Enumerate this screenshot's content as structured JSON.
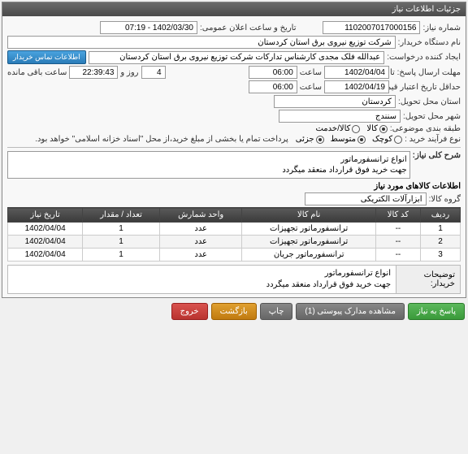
{
  "panel_title": "جزئیات اطلاعات نیاز",
  "fields": {
    "need_no_label": "شماره نیاز:",
    "need_no": "1102007017000156",
    "announce_label": "تاریخ و ساعت اعلان عمومی:",
    "announce": "1402/03/30 - 07:19",
    "buyer_label": "نام دستگاه خریدار:",
    "buyer": "شرکت توزیع نیروی برق استان کردستان",
    "creator_label": "ایجاد کننده درخواست:",
    "creator": "عبدالله فلک مجدی کارشناس تدارکات شرکت توزیع نیروی برق استان کردستان",
    "contact_btn": "اطلاعات تماس خریدار",
    "deadline_label": "مهلت ارسال پاسخ:",
    "until": "تا تاریخ:",
    "deadline_date": "1402/04/04",
    "hour_label": "ساعت",
    "deadline_hour": "06:00",
    "days": "4",
    "days_label": "روز و",
    "remain": "22:39:43",
    "remain_label": "ساعت باقی مانده",
    "valid_label": "حداقل تاریخ اعتبار قیمت تا تاریخ:",
    "valid_date": "1402/04/19",
    "valid_hour": "06:00",
    "province_label": "استان محل تحویل:",
    "province": "کردستان",
    "city_label": "شهر محل تحویل:",
    "city": "سنندج",
    "class_label": "طبقه بندی موضوعی:",
    "opt_kala": "کالا",
    "opt_service": "کالا/خدمت",
    "process_label": "نوع فرآیند خرید :",
    "opt_small": "کوچک",
    "opt_medium": "متوسط",
    "opt_partial": "جزئی",
    "process_note": "پرداخت تمام یا بخشی از مبلغ خرید،از محل \"اسناد خزانه اسلامی\" خواهد بود.",
    "desc_label": "شرح کلی نیاز:",
    "desc_line1": "انواع ترانسفورماتور",
    "desc_line2": "جهت خرید فوق قرارداد منعقد میگردد",
    "items_title": "اطلاعات کالاهای مورد نیاز",
    "group_label": "گروه کالا:",
    "group": "ابزارآلات الکتریکی"
  },
  "table": {
    "headers": [
      "ردیف",
      "کد کالا",
      "نام کالا",
      "واحد شمارش",
      "تعداد / مقدار",
      "تاریخ نیاز"
    ],
    "rows": [
      {
        "idx": "1",
        "code": "--",
        "name": "ترانسفورماتور تجهیزات",
        "unit": "عدد",
        "qty": "1",
        "date": "1402/04/04"
      },
      {
        "idx": "2",
        "code": "--",
        "name": "ترانسفورماتور تجهیزات",
        "unit": "عدد",
        "qty": "1",
        "date": "1402/04/04"
      },
      {
        "idx": "3",
        "code": "--",
        "name": "ترانسفورماتور جریان",
        "unit": "عدد",
        "qty": "1",
        "date": "1402/04/04"
      }
    ]
  },
  "buyer_notes_label": "توضیحات خریدار:",
  "buyer_notes_l1": "انواع ترانسفورماتور",
  "buyer_notes_l2": "جهت خرید فوق قرارداد منعقد میگردد",
  "buttons": {
    "reply": "پاسخ به نیاز",
    "attach": "مشاهده مدارک پیوستی (1)",
    "print": "چاپ",
    "back": "بازگشت",
    "exit": "خروج"
  }
}
